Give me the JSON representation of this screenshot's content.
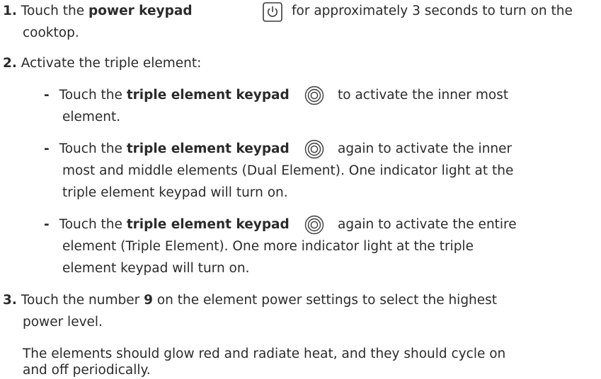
{
  "steps": [
    {
      "number": "1.",
      "pre": "Touch the ",
      "bold": "power keypad",
      "icon": "power-icon",
      "post_line1": "for approximately 3 seconds to turn on the",
      "post_line2": "cooktop."
    },
    {
      "number": "2.",
      "text": "Activate the triple element:",
      "substeps": [
        {
          "pre": "Touch the ",
          "bold": "triple element keypad",
          "icon": "triple-element-icon",
          "lines": [
            "to activate the inner most",
            "element."
          ]
        },
        {
          "pre": "Touch the ",
          "bold": "triple element keypad",
          "icon": "triple-element-icon",
          "lines": [
            "again to activate the inner",
            "most and middle elements (Dual Element). One indicator light at the",
            "triple element keypad will turn on."
          ]
        },
        {
          "pre": "Touch the ",
          "bold": "triple element keypad",
          "icon": "triple-element-icon",
          "lines": [
            "again to activate the entire",
            "element (Triple Element). One more indicator light at the triple",
            "element keypad will turn on."
          ]
        }
      ]
    },
    {
      "number": "3.",
      "pre": "Touch the number ",
      "bold": "9",
      "post_line1": " on the element power settings to select the highest",
      "post_line2": "power level.",
      "note_lines": [
        "The elements should glow red and radiate heat, and they should cycle on",
        "and off periodically."
      ]
    }
  ],
  "dash": "-"
}
